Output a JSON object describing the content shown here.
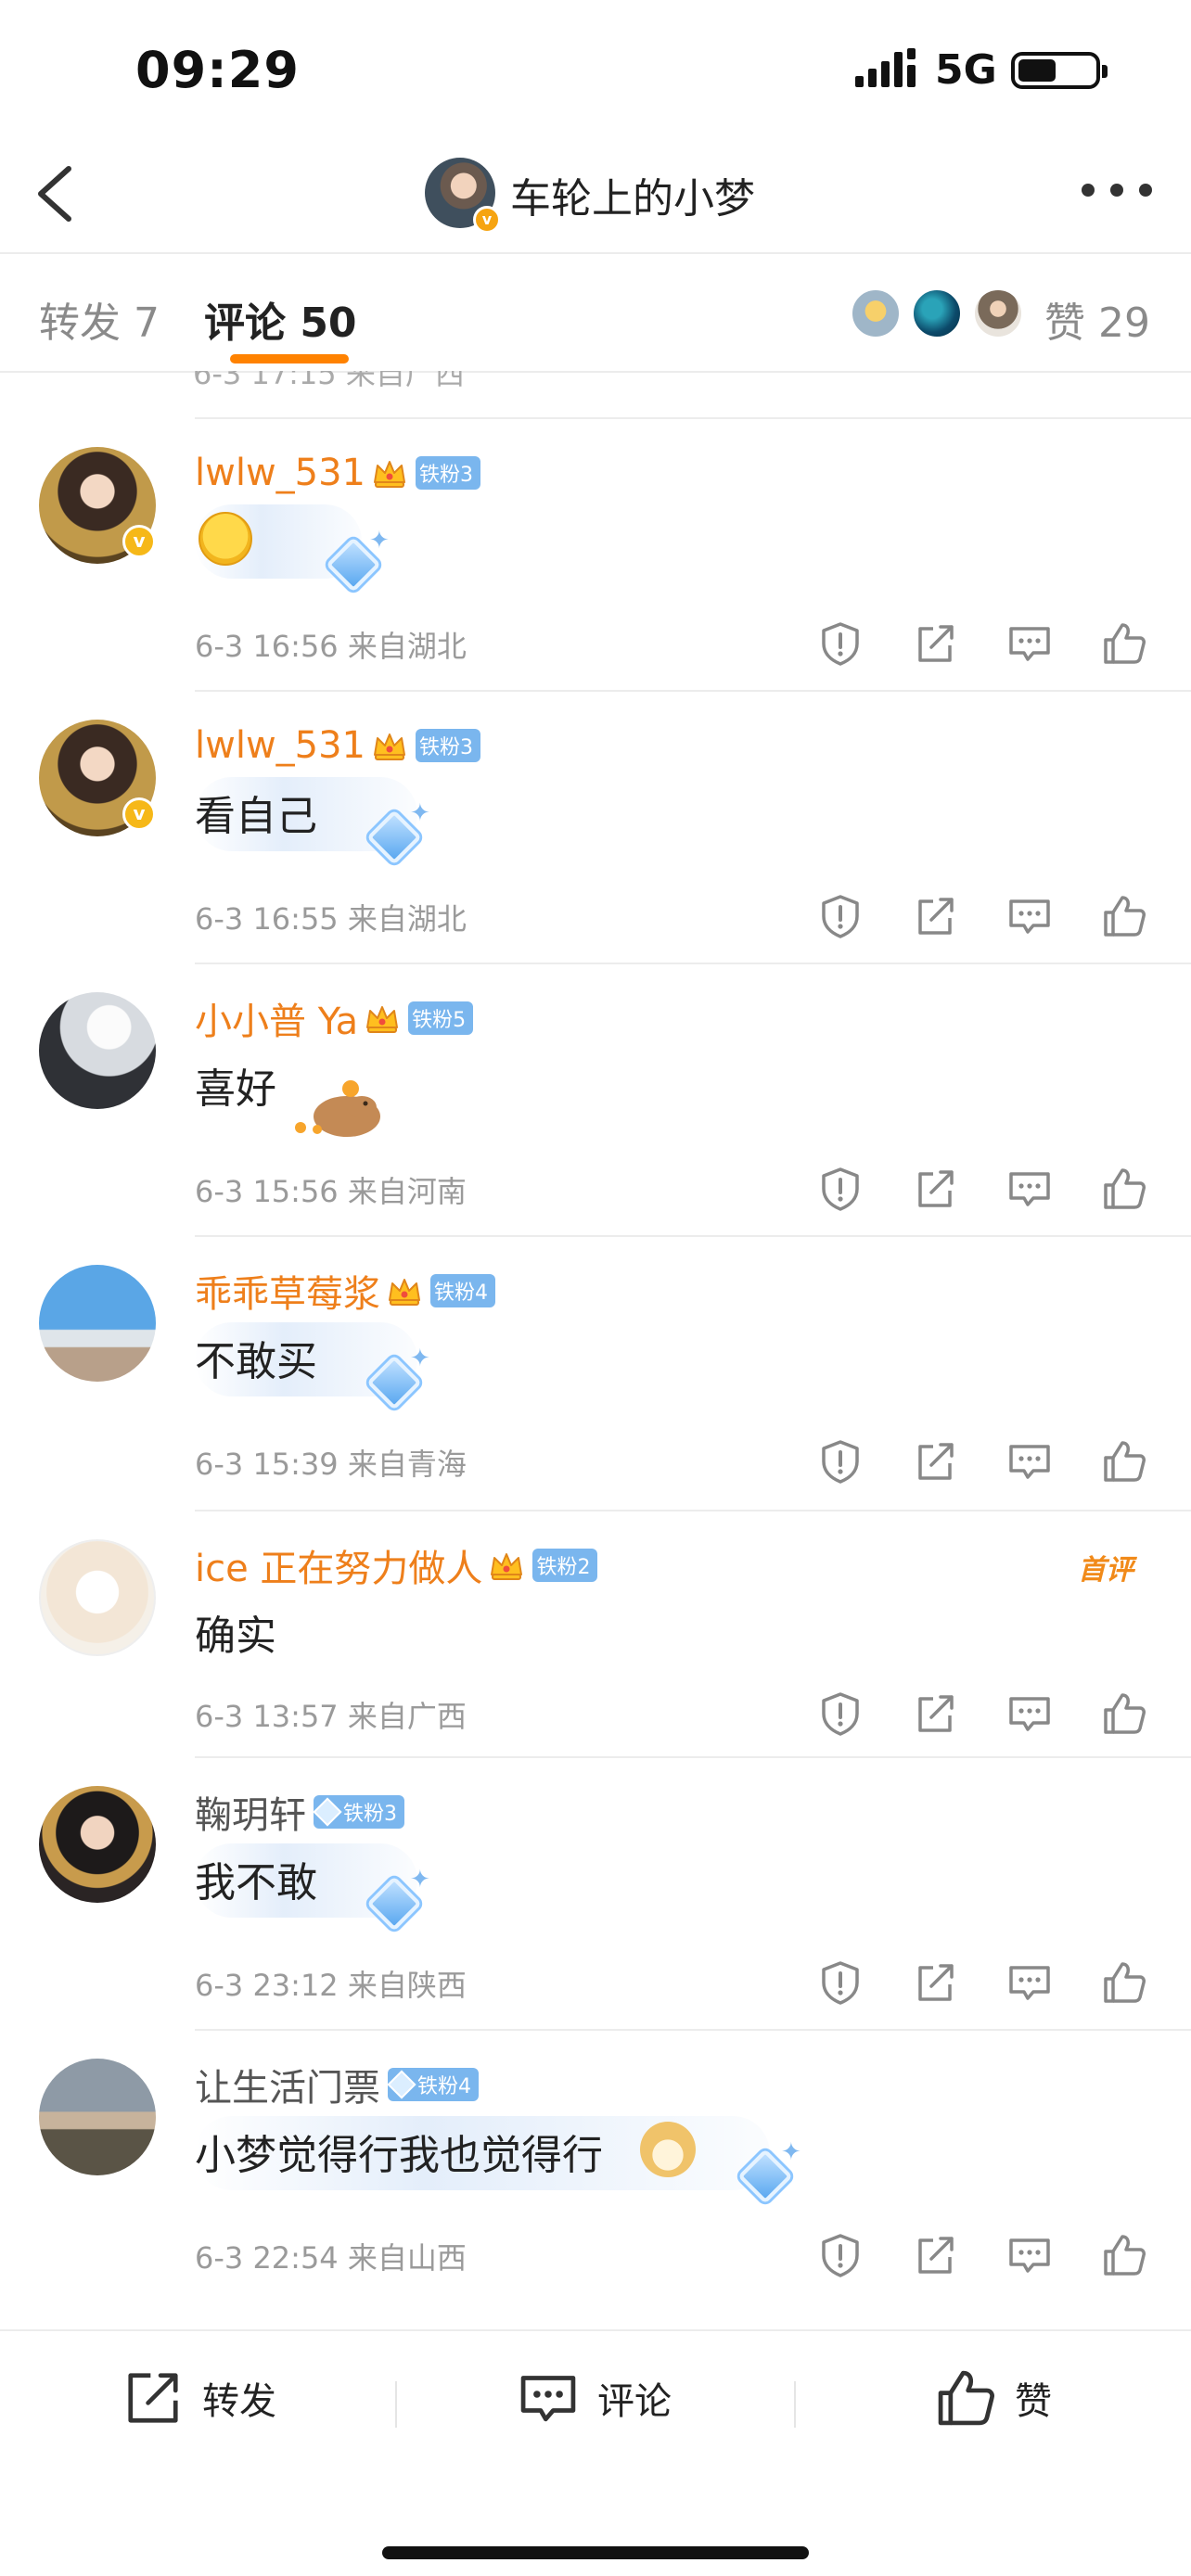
{
  "status": {
    "time": "09:29",
    "network": "5G"
  },
  "header": {
    "title": "车轮上的小梦",
    "verified": "v"
  },
  "tabs": {
    "repost": "转发 7",
    "comment": "评论 50",
    "likes": "赞 29"
  },
  "partial_meta": "6-3 17:15 来自广西",
  "comments": [
    {
      "user": "lwlw_531",
      "fan": "铁粉3",
      "text": "",
      "emoji": "laughing-tears-emoji",
      "meta": "6-3 16:56 来自湖北"
    },
    {
      "user": "lwlw_531",
      "fan": "铁粉3",
      "text": "看自己",
      "meta": "6-3 16:55 来自湖北"
    },
    {
      "user": "小小普 Ya",
      "fan": "铁粉5",
      "text": "喜好",
      "emoji": "capybara-sticker",
      "meta": "6-3 15:56 来自河南"
    },
    {
      "user": "乖乖草莓浆",
      "fan": "铁粉4",
      "text": "不敢买",
      "meta": "6-3 15:39 来自青海"
    },
    {
      "user": "ice 正在努力做人",
      "fan": "铁粉2",
      "text": "确实",
      "tag": "首评",
      "meta": "6-3 13:57 来自广西"
    },
    {
      "user": "鞠玥轩",
      "fan": "铁粉3",
      "text": "我不敢",
      "meta": "6-3 23:12 来自陕西"
    },
    {
      "user": "让生活门票",
      "fan": "铁粉4",
      "text": "小梦觉得行我也觉得行",
      "emoji": "doge-emoji",
      "meta": "6-3 22:54 来自山西"
    }
  ],
  "bottom": {
    "repost": "转发",
    "comment": "评论",
    "like": "赞"
  },
  "colors": {
    "accent": "#ff8200",
    "username": "#ee7f1b",
    "fan_badge": "#7ab6ee"
  }
}
